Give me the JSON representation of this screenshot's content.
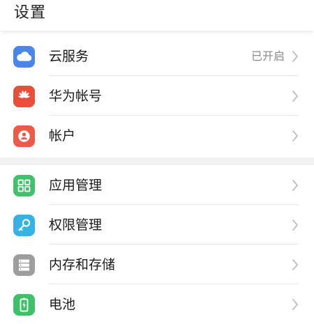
{
  "header": {
    "title": "设置"
  },
  "groups": [
    {
      "items": [
        {
          "label": "云服务",
          "value": "已开启",
          "icon": "cloud-icon",
          "icon_color": "#4a86e8"
        },
        {
          "label": "华为帐号",
          "value": "",
          "icon": "huawei-logo-icon",
          "icon_color": "#ea4d3c"
        },
        {
          "label": "帐户",
          "value": "",
          "icon": "user-account-icon",
          "icon_color": "#ee5a4a"
        }
      ]
    },
    {
      "items": [
        {
          "label": "应用管理",
          "value": "",
          "icon": "app-grid-icon",
          "icon_color": "#43c06e"
        },
        {
          "label": "权限管理",
          "value": "",
          "icon": "key-icon",
          "icon_color": "#36b3e3"
        },
        {
          "label": "内存和存储",
          "value": "",
          "icon": "storage-icon",
          "icon_color": "#9e9e9e"
        },
        {
          "label": "电池",
          "value": "",
          "icon": "battery-icon",
          "icon_color": "#3fbf6a"
        }
      ]
    }
  ],
  "colors": {
    "header_bg": "#ffffff",
    "section_gap": "#f1f1f1",
    "secondary_text": "#8a8a8a",
    "chevron": "#bdbdbd"
  }
}
